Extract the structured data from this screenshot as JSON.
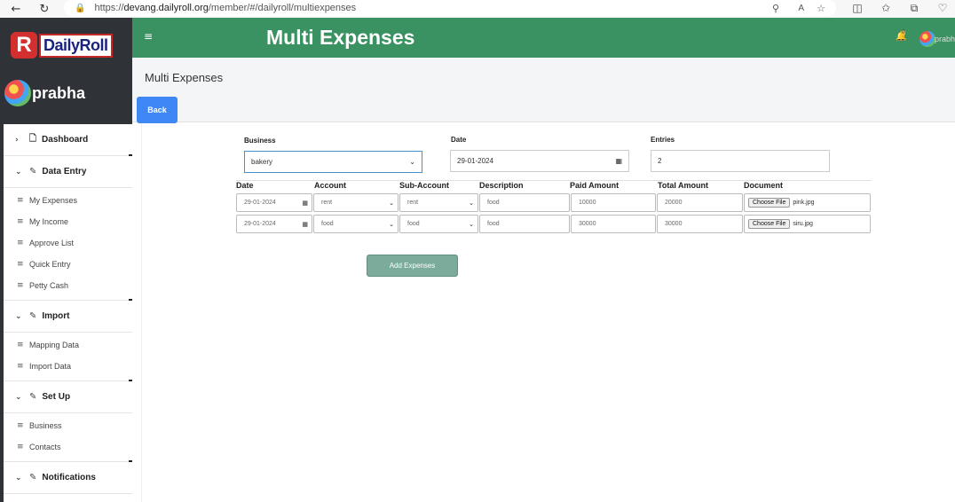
{
  "browser": {
    "url_prefix": "https://",
    "url_host": "devang.dailyroll.org",
    "url_path": "/member/#/dailyroll/multiexpenses"
  },
  "sidebar": {
    "logo_text": "DailyRoll",
    "logo_letter": "R",
    "user_name": "prabha",
    "sections": [
      {
        "label": "Dashboard",
        "expanded": false,
        "items": []
      },
      {
        "label": "Data Entry",
        "expanded": true,
        "items": [
          "My Expenses",
          "My Income",
          "Approve List",
          "Quick Entry",
          "Petty Cash"
        ]
      },
      {
        "label": "Import",
        "expanded": true,
        "items": [
          "Mapping Data",
          "Import Data"
        ]
      },
      {
        "label": "Set Up",
        "expanded": true,
        "items": [
          "Business",
          "Contacts"
        ]
      },
      {
        "label": "Notifications",
        "expanded": true,
        "items": []
      }
    ]
  },
  "header": {
    "title": "Multi Expenses",
    "notification_count": "0",
    "user_name": "prabh"
  },
  "page": {
    "title": "Multi Expenses",
    "back_label": "Back"
  },
  "form": {
    "business_label": "Business",
    "business_value": "bakery",
    "date_label": "Date",
    "date_value": "29-01-2024",
    "entries_label": "Entries",
    "entries_value": "2"
  },
  "table": {
    "columns": [
      "Date",
      "Account",
      "Sub-Account",
      "Description",
      "Paid Amount",
      "Total Amount",
      "Document"
    ],
    "choose_file_label": "Choose File",
    "rows": [
      {
        "date": "29-01-2024",
        "account": "rent",
        "sub_account": "rent",
        "description": "food",
        "paid": "10000",
        "total": "20000",
        "document": "pink.jpg"
      },
      {
        "date": "29-01-2024",
        "account": "food",
        "sub_account": "food",
        "description": "food",
        "paid": "30000",
        "total": "30000",
        "document": "siru.jpg"
      }
    ]
  },
  "actions": {
    "add_label": "Add Expenses"
  },
  "colors": {
    "header_green": "#3a9162",
    "sidebar_dark": "#2f3338",
    "back_blue": "#3f87f5",
    "add_button": "#7aab9b"
  }
}
